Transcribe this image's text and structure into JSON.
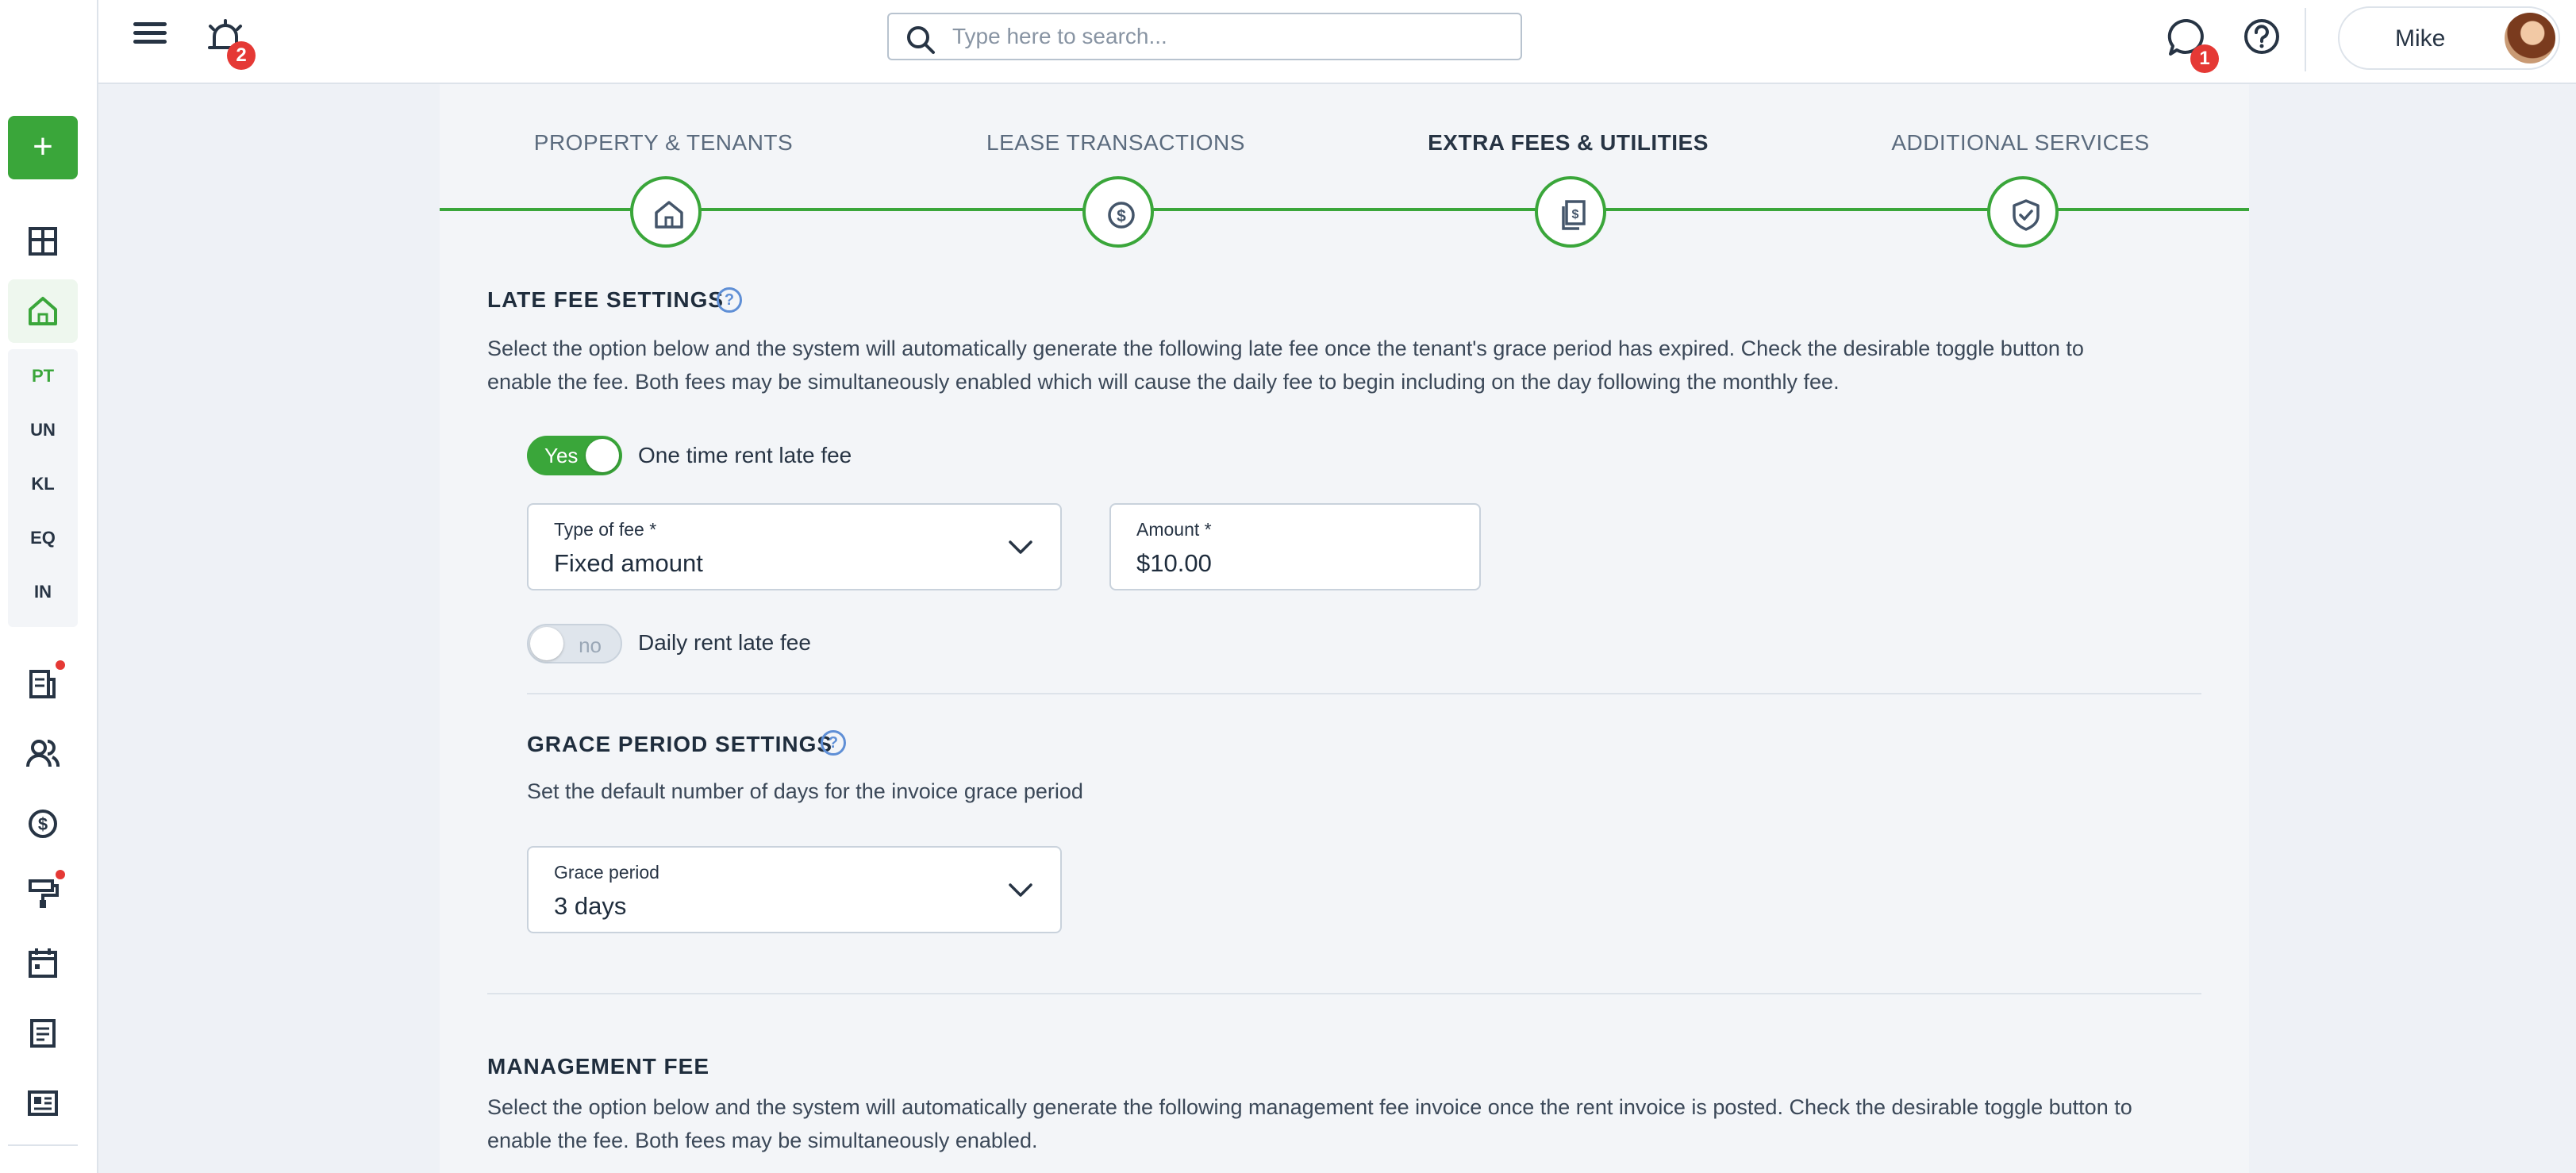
{
  "header": {
    "notifications_count": "2",
    "search_placeholder": "Type here to search...",
    "messages_count": "1",
    "user_name": "Mike"
  },
  "sidebar": {
    "add_label": "+",
    "sub_items": [
      "PT",
      "UN",
      "KL",
      "EQ",
      "IN"
    ]
  },
  "steps": [
    {
      "label": "PROPERTY & TENANTS"
    },
    {
      "label": "LEASE TRANSACTIONS"
    },
    {
      "label": "EXTRA FEES & UTILITIES"
    },
    {
      "label": "ADDITIONAL SERVICES"
    }
  ],
  "late_fee": {
    "title": "LATE FEE SETTINGS",
    "help": "?",
    "description_line1": "Select the option below and the system will automatically generate the following late fee once the tenant's grace period has expired. Check the desirable toggle button to",
    "description_line2": "enable the fee. Both fees may be simultaneously enabled which will cause the daily fee to begin including on the day following the monthly fee.",
    "one_time_toggle": {
      "state_label": "Yes",
      "label": "One time rent late fee"
    },
    "type_of_fee": {
      "label": "Type of fee *",
      "value": "Fixed amount"
    },
    "amount": {
      "label": "Amount *",
      "value": "$10.00"
    },
    "daily_toggle": {
      "state_label": "no",
      "label": "Daily rent late fee"
    }
  },
  "grace_period": {
    "title": "GRACE PERIOD SETTINGS",
    "help": "?",
    "description": "Set the default number of days for the invoice grace period",
    "field": {
      "label": "Grace period",
      "value": "3 days"
    }
  },
  "management_fee": {
    "title": "MANAGEMENT FEE",
    "description_line1": "Select the option below and the system will automatically generate the following management fee invoice once the rent invoice is posted. Check the desirable toggle button to",
    "description_line2": "enable the fee. Both fees may be simultaneously enabled."
  },
  "colors": {
    "accent": "#3aa63a",
    "badge": "#e53935",
    "help": "#5f8fd6"
  }
}
